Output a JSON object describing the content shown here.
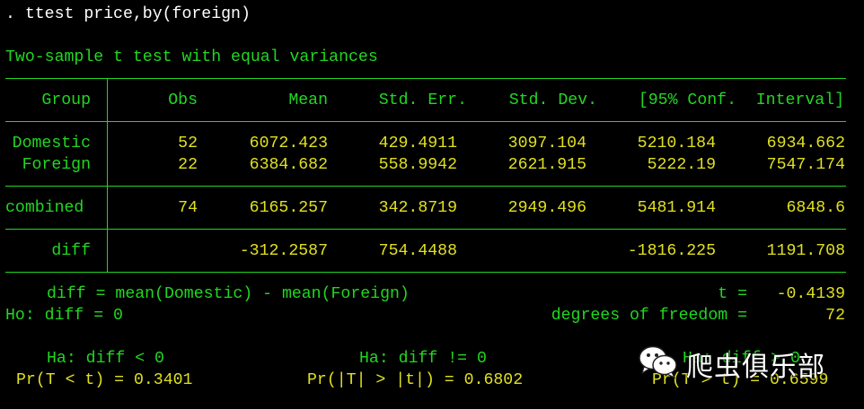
{
  "command": ". ttest price,by(foreign)",
  "test_title": "Two-sample t test with equal variances",
  "table": {
    "headers": [
      "Group",
      "Obs",
      "Mean",
      "Std. Err.",
      "Std. Dev.",
      "[95% Conf.",
      "Interval]"
    ],
    "rows": [
      {
        "group": "Domestic",
        "obs": "52",
        "mean": "6072.423",
        "se": "429.4911",
        "sd": "3097.104",
        "lo": "5210.184",
        "hi": "6934.662"
      },
      {
        "group": "Foreign",
        "obs": "22",
        "mean": "6384.682",
        "se": "558.9942",
        "sd": "2621.915",
        "lo": "5222.19",
        "hi": "7547.174"
      }
    ],
    "combined": {
      "group": "combined",
      "obs": "74",
      "mean": "6165.257",
      "se": "342.8719",
      "sd": "2949.496",
      "lo": "5481.914",
      "hi": "6848.6"
    },
    "diff": {
      "group": "diff",
      "mean": "-312.2587",
      "se": "754.4488",
      "lo": "-1816.225",
      "hi": "1191.708"
    }
  },
  "summary": {
    "diff_def": "diff = mean(Domestic) - mean(Foreign)",
    "t_label": "t =",
    "t_value": "-0.4139",
    "ho": "Ho: diff = 0",
    "df_label": "degrees of freedom =",
    "df_value": "72"
  },
  "alternatives": {
    "left": {
      "label": "Ha: diff < 0",
      "pr": "Pr(T < t) = 0.3401"
    },
    "middle": {
      "label": "Ha: diff != 0",
      "pr": "Pr(|T| > |t|) = 0.6802"
    },
    "right": {
      "label": "Ha: diff > 0",
      "pr": "Pr(T > t) = 0.6599"
    }
  },
  "watermark": {
    "icon": "wechat-icon",
    "text": "爬虫俱乐部"
  },
  "colors": {
    "background": "#000000",
    "command_text": "#ffffff",
    "label_text": "#22d622",
    "value_text": "#e0e020",
    "rule_lines": "#22d622"
  }
}
